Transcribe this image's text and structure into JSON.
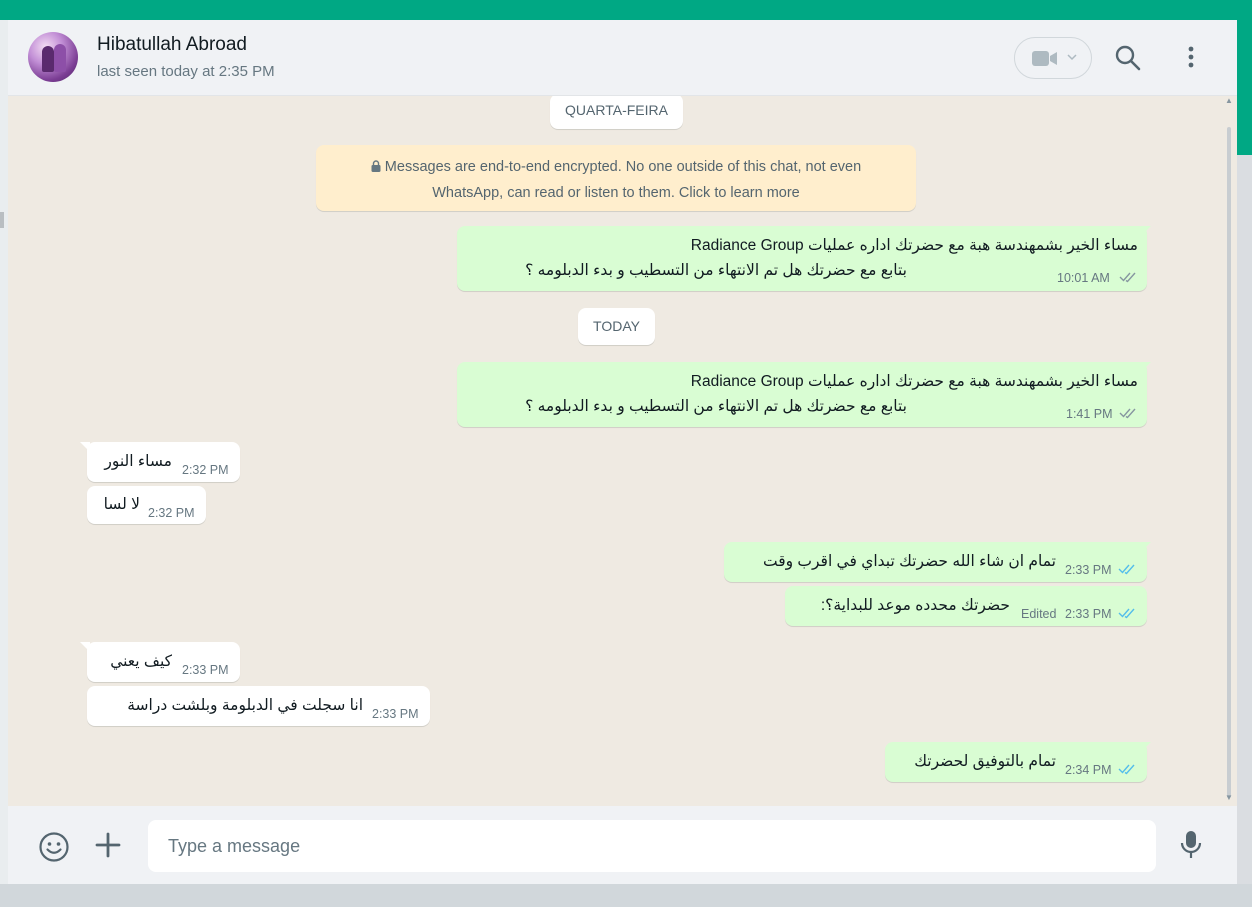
{
  "header": {
    "contact_name": "Hibatullah Abroad",
    "contact_status": "last seen today at 2:35 PM"
  },
  "chat": {
    "date_chips": [
      "QUARTA-FEIRA",
      "TODAY"
    ],
    "encryption_line1": "Messages are end-to-end encrypted. No one outside of this chat, not even",
    "encryption_line2": "WhatsApp, can read or listen to them. Click to learn more",
    "messages": [
      {
        "direction": "out",
        "line1": "مساء الخير بشمهندسة هبة مع  حضرتك اداره عمليات Radiance Group",
        "line2": "بتابع مع حضرتك هل تم الانتهاء من التسطيب و بدء الدبلومه ؟",
        "time": "10:01 AM",
        "status": "sent"
      },
      {
        "direction": "out",
        "line1": "مساء الخير بشمهندسة هبة مع  حضرتك اداره عمليات Radiance Group",
        "line2": "بتابع مع حضرتك هل تم الانتهاء من التسطيب و بدء الدبلومه ؟",
        "time": "1:41 PM",
        "status": "sent"
      },
      {
        "direction": "in",
        "text": "مساء النور",
        "time": "2:32 PM"
      },
      {
        "direction": "in",
        "text": "لا لسا",
        "time": "2:32 PM"
      },
      {
        "direction": "out",
        "text": "تمام ان شاء الله حضرتك تبداي في اقرب وقت",
        "time": "2:33 PM",
        "status": "read"
      },
      {
        "direction": "out",
        "text": "حضرتك محدده موعد للبداية؟:",
        "edited": "Edited",
        "time": "2:33 PM",
        "status": "read"
      },
      {
        "direction": "in",
        "text": "كيف يعني",
        "time": "2:33 PM"
      },
      {
        "direction": "in",
        "text": "انا سجلت في الدبلومة وبلشت دراسة",
        "time": "2:33 PM"
      },
      {
        "direction": "out",
        "text": "تمام بالتوفيق لحضرتك",
        "time": "2:34 PM",
        "status": "read"
      }
    ]
  },
  "composer": {
    "placeholder": "Type a message"
  },
  "colors": {
    "accent": "#00a884",
    "outgoing_bubble": "#d9fdd3",
    "incoming_bubble": "#ffffff",
    "encryption_notice": "#ffeecd",
    "read_ticks": "#53bdeb",
    "sent_ticks": "#8696a0"
  },
  "icons": [
    "video-call-icon",
    "chevron-down-icon",
    "search-icon",
    "menu-icon",
    "lock-icon",
    "double-check-icon",
    "emoji-icon",
    "plus-icon",
    "mic-icon"
  ]
}
